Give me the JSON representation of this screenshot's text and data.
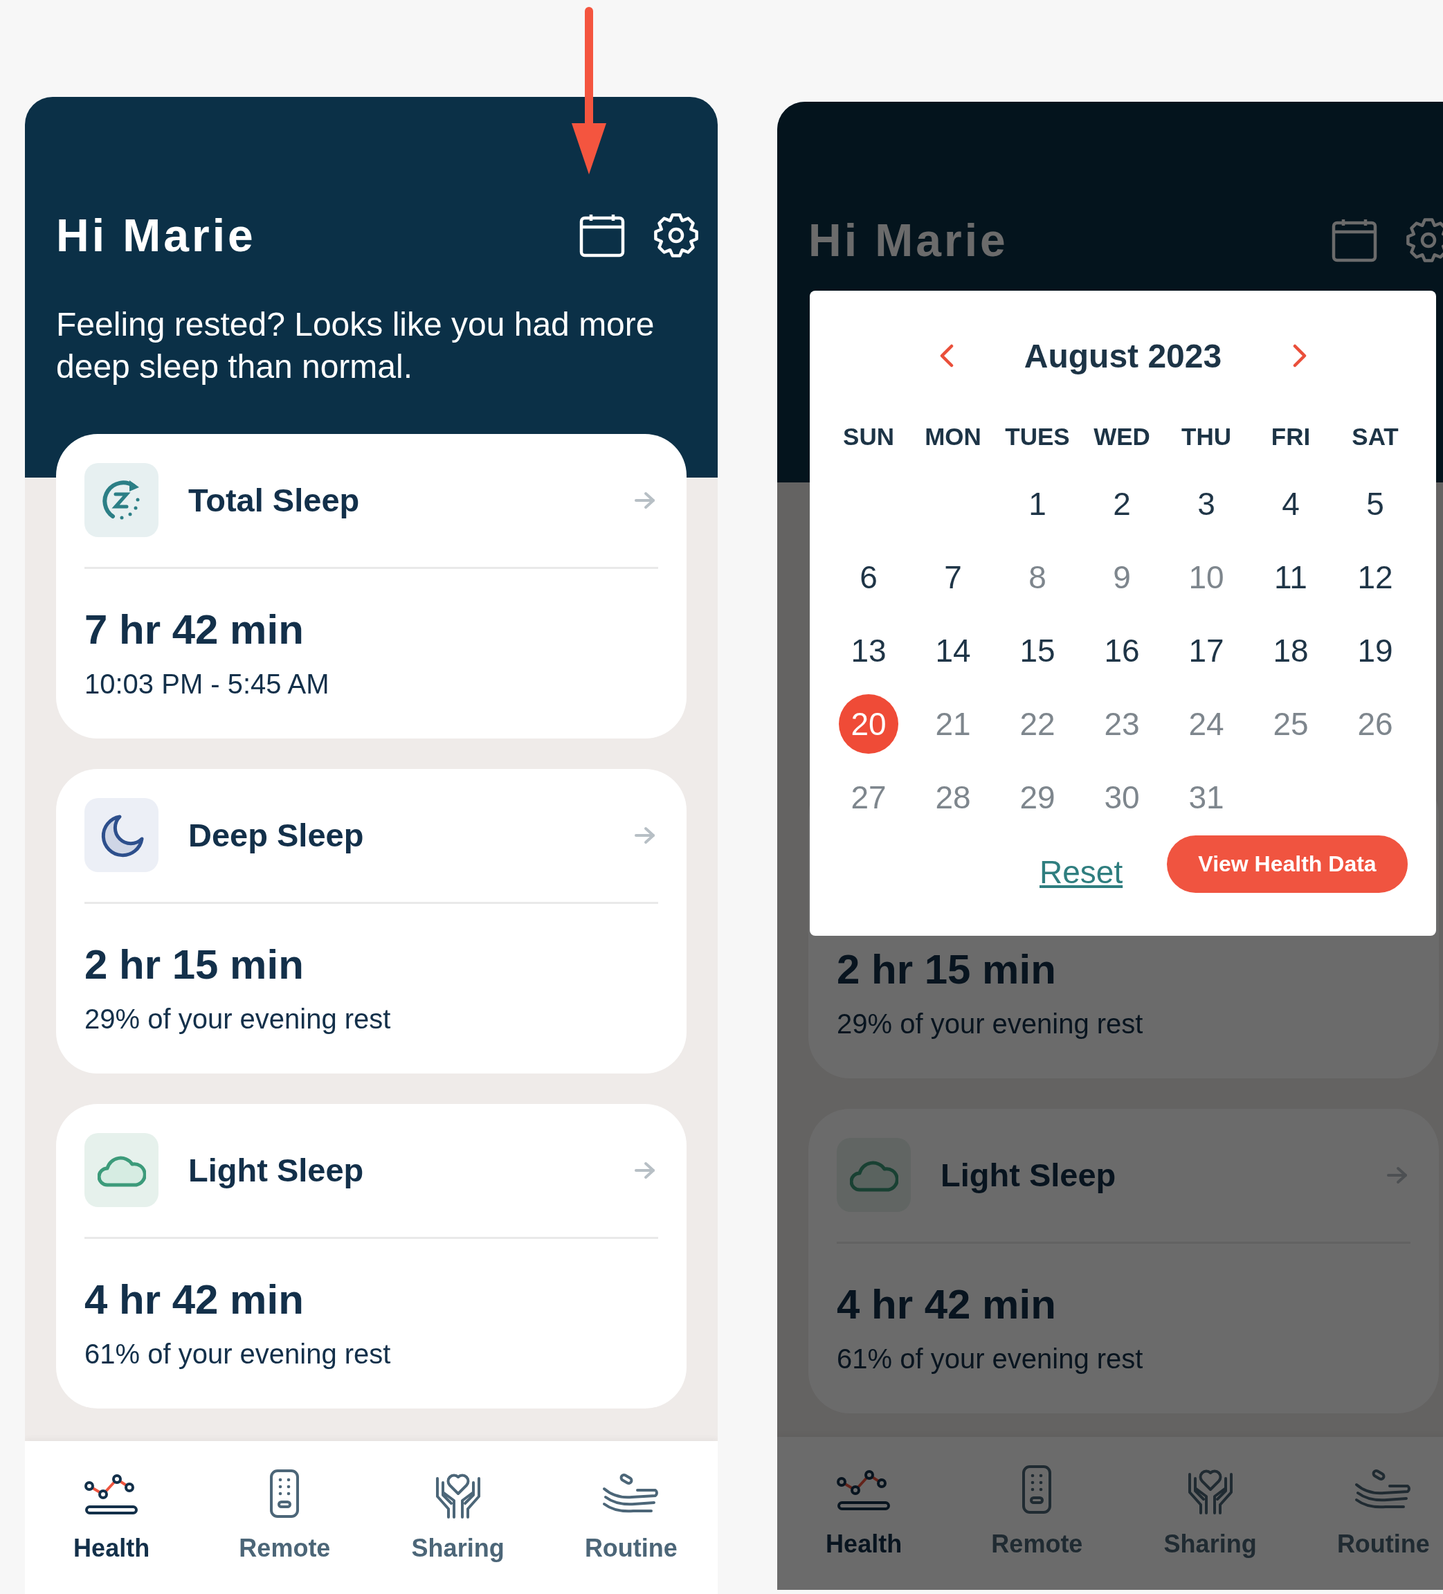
{
  "screens": [
    {
      "greeting": "Hi Marie",
      "message": "Feeling rested? Looks like you had more deep sleep than normal.",
      "cards": [
        {
          "kind": "total",
          "title": "Total Sleep",
          "value": "7 hr 42 min",
          "detail": "10:03 PM - 5:45 AM"
        },
        {
          "kind": "deep",
          "title": "Deep Sleep",
          "value": "2 hr 15 min",
          "detail": "29% of your evening rest"
        },
        {
          "kind": "light",
          "title": "Light Sleep",
          "value": "4 hr 42 min",
          "detail": "61% of your evening rest"
        }
      ],
      "nav": [
        {
          "kind": "health",
          "label": "Health",
          "selected": true
        },
        {
          "kind": "remote",
          "label": "Remote",
          "selected": false
        },
        {
          "kind": "sharing",
          "label": "Sharing",
          "selected": false
        },
        {
          "kind": "routine",
          "label": "Routine",
          "selected": false
        }
      ]
    },
    {
      "greeting": "Hi Marie",
      "cards": [
        {
          "value": "2 hr 15 min",
          "detail": "29% of your evening rest"
        },
        {
          "kind": "light",
          "title": "Light Sleep",
          "value": "4 hr 42 min",
          "detail": "61% of your evening rest"
        }
      ],
      "nav": [
        {
          "kind": "health",
          "label": "Health",
          "selected": true
        },
        {
          "kind": "remote",
          "label": "Remote",
          "selected": false
        },
        {
          "kind": "sharing",
          "label": "Sharing",
          "selected": false
        },
        {
          "kind": "routine",
          "label": "Routine",
          "selected": false
        }
      ],
      "date_picker": {
        "month": "August 2023",
        "weekdays": [
          "SUN",
          "MON",
          "TUES",
          "WED",
          "THU",
          "FRI",
          "SAT"
        ],
        "weeks": [
          [
            {
              "label": "1",
              "disabled": false,
              "selected": false
            },
            {
              "label": "2",
              "disabled": false,
              "selected": false
            },
            {
              "label": "3",
              "disabled": false,
              "selected": false
            },
            {
              "label": "4",
              "disabled": false,
              "selected": false
            },
            {
              "label": "5",
              "disabled": false,
              "selected": false
            }
          ],
          [
            {
              "label": "6",
              "disabled": false,
              "selected": false
            },
            {
              "label": "7",
              "disabled": false,
              "selected": false
            },
            {
              "label": "8",
              "disabled": true,
              "selected": false
            },
            {
              "label": "9",
              "disabled": true,
              "selected": false
            },
            {
              "label": "10",
              "disabled": true,
              "selected": false
            },
            {
              "label": "11",
              "disabled": false,
              "selected": false
            },
            {
              "label": "12",
              "disabled": false,
              "selected": false
            }
          ],
          [
            {
              "label": "13",
              "disabled": false,
              "selected": false
            },
            {
              "label": "14",
              "disabled": false,
              "selected": false
            },
            {
              "label": "15",
              "disabled": false,
              "selected": false
            },
            {
              "label": "16",
              "disabled": false,
              "selected": false
            },
            {
              "label": "17",
              "disabled": false,
              "selected": false
            },
            {
              "label": "18",
              "disabled": false,
              "selected": false
            },
            {
              "label": "19",
              "disabled": false,
              "selected": false
            }
          ],
          [
            {
              "label": "20",
              "disabled": false,
              "selected": true
            },
            {
              "label": "21",
              "disabled": true,
              "selected": false
            },
            {
              "label": "22",
              "disabled": true,
              "selected": false
            },
            {
              "label": "23",
              "disabled": true,
              "selected": false
            },
            {
              "label": "24",
              "disabled": true,
              "selected": false
            },
            {
              "label": "25",
              "disabled": true,
              "selected": false
            },
            {
              "label": "26",
              "disabled": true,
              "selected": false
            }
          ],
          [
            {
              "label": "27",
              "disabled": true,
              "selected": false
            },
            {
              "label": "28",
              "disabled": true,
              "selected": false
            },
            {
              "label": "29",
              "disabled": true,
              "selected": false
            },
            {
              "label": "30",
              "disabled": true,
              "selected": false
            },
            {
              "label": "31",
              "disabled": true,
              "selected": false
            }
          ]
        ],
        "reset": "Reset",
        "action": "View Health Data"
      }
    }
  ]
}
